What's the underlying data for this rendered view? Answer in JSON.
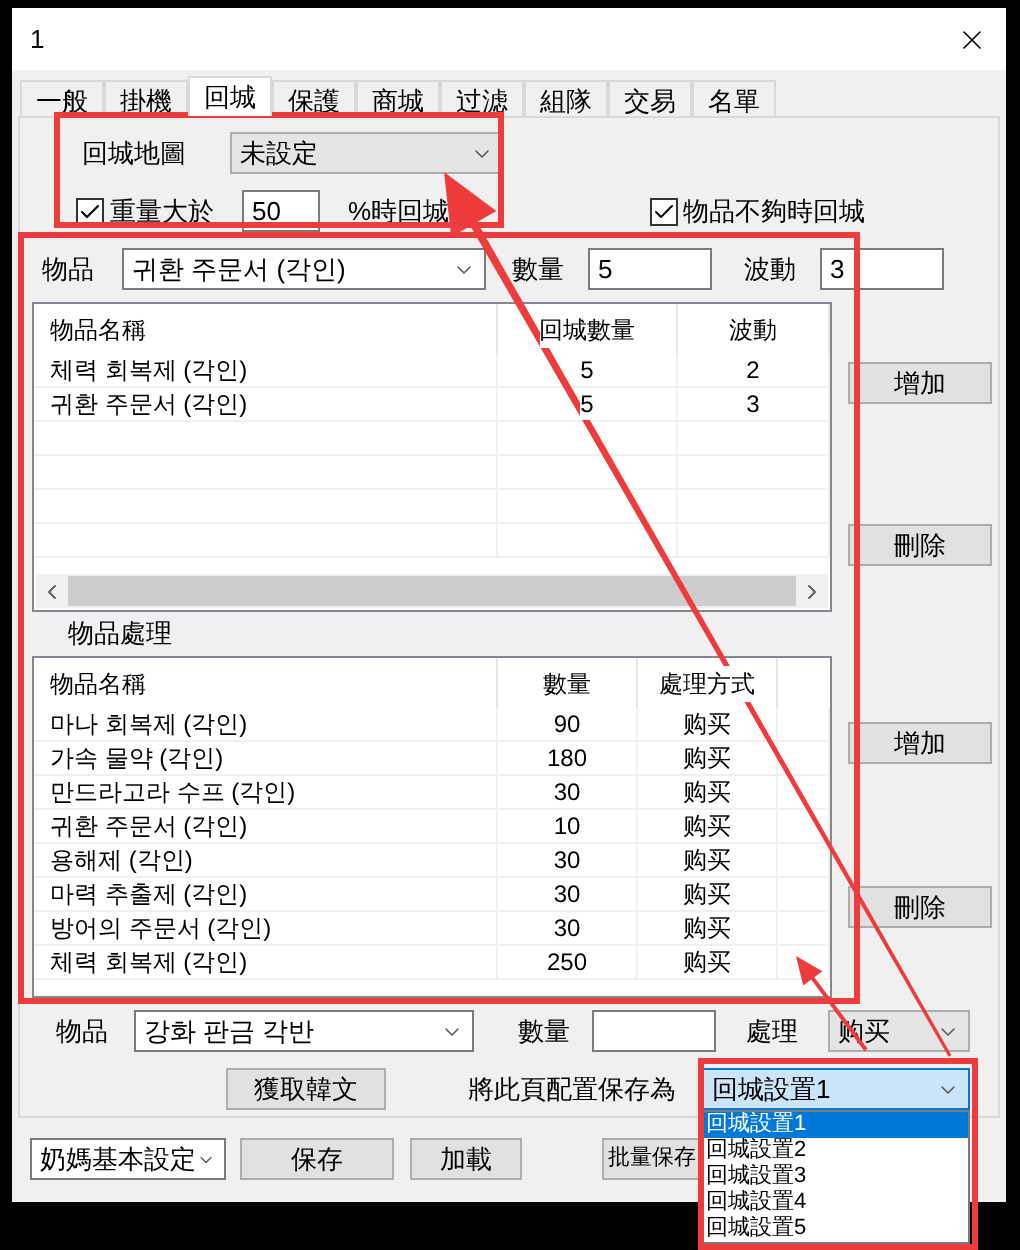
{
  "window": {
    "title": "1"
  },
  "tabs": [
    {
      "label": "一般",
      "selected": false
    },
    {
      "label": "掛機",
      "selected": false
    },
    {
      "label": "回城",
      "selected": true
    },
    {
      "label": "保護",
      "selected": false
    },
    {
      "label": "商城",
      "selected": false
    },
    {
      "label": "过滤",
      "selected": false
    },
    {
      "label": "組隊",
      "selected": false
    },
    {
      "label": "交易",
      "selected": false
    },
    {
      "label": "名單",
      "selected": false
    }
  ],
  "map_row": {
    "label": "回城地圖",
    "value": "未設定"
  },
  "weight": {
    "checked": true,
    "label": "重量大於",
    "value": "50",
    "suffix": "%時回城"
  },
  "shortage": {
    "checked": true,
    "label": "物品不夠時回城"
  },
  "item_row": {
    "item_label": "物品",
    "item_value": "귀환 주문서 (각인)",
    "qty_label": "數量",
    "qty_value": "5",
    "var_label": "波動",
    "var_value": "3"
  },
  "return_table": {
    "columns": [
      "物品名稱",
      "回城數量",
      "波動"
    ],
    "rows": [
      [
        "체력 회복제 (각인)",
        "5",
        "2"
      ],
      [
        "귀환 주문서 (각인)",
        "5",
        "3"
      ]
    ]
  },
  "return_buttons": [
    "增加",
    "刪除"
  ],
  "process_label": "物品處理",
  "process_table": {
    "columns": [
      "物品名稱",
      "數量",
      "處理方式"
    ],
    "rows": [
      [
        "마나 회복제 (각인)",
        "90",
        "购买"
      ],
      [
        "가속 물약 (각인)",
        "180",
        "购买"
      ],
      [
        "만드라고라 수프 (각인)",
        "30",
        "购买"
      ],
      [
        "귀환 주문서 (각인)",
        "10",
        "购买"
      ],
      [
        "용해제 (각인)",
        "30",
        "购买"
      ],
      [
        "마력 추출제 (각인)",
        "30",
        "购买"
      ],
      [
        "방어의 주문서 (각인)",
        "30",
        "购买"
      ],
      [
        "체력 회복제 (각인)",
        "250",
        "购买"
      ]
    ]
  },
  "process_buttons": [
    "增加",
    "刪除"
  ],
  "process_row": {
    "item_label": "物品",
    "item_value": "강화 판금 각반",
    "qty_label": "數量",
    "action_label": "處理",
    "action_value": "购买"
  },
  "fetch_button": "獲取韓文",
  "save_as": {
    "label": "將此頁配置保存為",
    "value": "回城設置1",
    "options": [
      {
        "label": "回城設置1",
        "selected": true
      },
      {
        "label": "回城設置2",
        "selected": false
      },
      {
        "label": "回城設置3",
        "selected": false
      },
      {
        "label": "回城設置4",
        "selected": false
      },
      {
        "label": "回城設置5",
        "selected": false
      }
    ]
  },
  "footer": {
    "profile": "奶媽基本設定",
    "buttons": [
      "保存",
      "加載",
      "批量保存"
    ]
  }
}
